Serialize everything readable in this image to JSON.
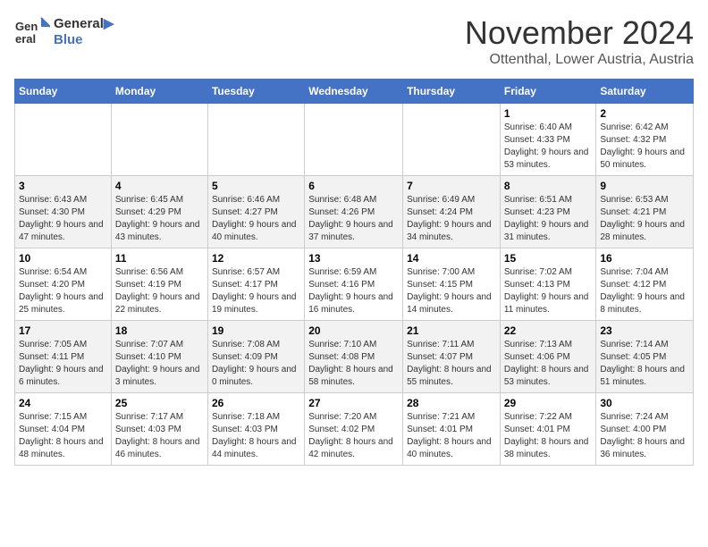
{
  "logo": {
    "line1": "General",
    "line2": "Blue"
  },
  "title": "November 2024",
  "subtitle": "Ottenthal, Lower Austria, Austria",
  "days_of_week": [
    "Sunday",
    "Monday",
    "Tuesday",
    "Wednesday",
    "Thursday",
    "Friday",
    "Saturday"
  ],
  "weeks": [
    [
      {
        "day": "",
        "info": ""
      },
      {
        "day": "",
        "info": ""
      },
      {
        "day": "",
        "info": ""
      },
      {
        "day": "",
        "info": ""
      },
      {
        "day": "",
        "info": ""
      },
      {
        "day": "1",
        "info": "Sunrise: 6:40 AM\nSunset: 4:33 PM\nDaylight: 9 hours and 53 minutes."
      },
      {
        "day": "2",
        "info": "Sunrise: 6:42 AM\nSunset: 4:32 PM\nDaylight: 9 hours and 50 minutes."
      }
    ],
    [
      {
        "day": "3",
        "info": "Sunrise: 6:43 AM\nSunset: 4:30 PM\nDaylight: 9 hours and 47 minutes."
      },
      {
        "day": "4",
        "info": "Sunrise: 6:45 AM\nSunset: 4:29 PM\nDaylight: 9 hours and 43 minutes."
      },
      {
        "day": "5",
        "info": "Sunrise: 6:46 AM\nSunset: 4:27 PM\nDaylight: 9 hours and 40 minutes."
      },
      {
        "day": "6",
        "info": "Sunrise: 6:48 AM\nSunset: 4:26 PM\nDaylight: 9 hours and 37 minutes."
      },
      {
        "day": "7",
        "info": "Sunrise: 6:49 AM\nSunset: 4:24 PM\nDaylight: 9 hours and 34 minutes."
      },
      {
        "day": "8",
        "info": "Sunrise: 6:51 AM\nSunset: 4:23 PM\nDaylight: 9 hours and 31 minutes."
      },
      {
        "day": "9",
        "info": "Sunrise: 6:53 AM\nSunset: 4:21 PM\nDaylight: 9 hours and 28 minutes."
      }
    ],
    [
      {
        "day": "10",
        "info": "Sunrise: 6:54 AM\nSunset: 4:20 PM\nDaylight: 9 hours and 25 minutes."
      },
      {
        "day": "11",
        "info": "Sunrise: 6:56 AM\nSunset: 4:19 PM\nDaylight: 9 hours and 22 minutes."
      },
      {
        "day": "12",
        "info": "Sunrise: 6:57 AM\nSunset: 4:17 PM\nDaylight: 9 hours and 19 minutes."
      },
      {
        "day": "13",
        "info": "Sunrise: 6:59 AM\nSunset: 4:16 PM\nDaylight: 9 hours and 16 minutes."
      },
      {
        "day": "14",
        "info": "Sunrise: 7:00 AM\nSunset: 4:15 PM\nDaylight: 9 hours and 14 minutes."
      },
      {
        "day": "15",
        "info": "Sunrise: 7:02 AM\nSunset: 4:13 PM\nDaylight: 9 hours and 11 minutes."
      },
      {
        "day": "16",
        "info": "Sunrise: 7:04 AM\nSunset: 4:12 PM\nDaylight: 9 hours and 8 minutes."
      }
    ],
    [
      {
        "day": "17",
        "info": "Sunrise: 7:05 AM\nSunset: 4:11 PM\nDaylight: 9 hours and 6 minutes."
      },
      {
        "day": "18",
        "info": "Sunrise: 7:07 AM\nSunset: 4:10 PM\nDaylight: 9 hours and 3 minutes."
      },
      {
        "day": "19",
        "info": "Sunrise: 7:08 AM\nSunset: 4:09 PM\nDaylight: 9 hours and 0 minutes."
      },
      {
        "day": "20",
        "info": "Sunrise: 7:10 AM\nSunset: 4:08 PM\nDaylight: 8 hours and 58 minutes."
      },
      {
        "day": "21",
        "info": "Sunrise: 7:11 AM\nSunset: 4:07 PM\nDaylight: 8 hours and 55 minutes."
      },
      {
        "day": "22",
        "info": "Sunrise: 7:13 AM\nSunset: 4:06 PM\nDaylight: 8 hours and 53 minutes."
      },
      {
        "day": "23",
        "info": "Sunrise: 7:14 AM\nSunset: 4:05 PM\nDaylight: 8 hours and 51 minutes."
      }
    ],
    [
      {
        "day": "24",
        "info": "Sunrise: 7:15 AM\nSunset: 4:04 PM\nDaylight: 8 hours and 48 minutes."
      },
      {
        "day": "25",
        "info": "Sunrise: 7:17 AM\nSunset: 4:03 PM\nDaylight: 8 hours and 46 minutes."
      },
      {
        "day": "26",
        "info": "Sunrise: 7:18 AM\nSunset: 4:03 PM\nDaylight: 8 hours and 44 minutes."
      },
      {
        "day": "27",
        "info": "Sunrise: 7:20 AM\nSunset: 4:02 PM\nDaylight: 8 hours and 42 minutes."
      },
      {
        "day": "28",
        "info": "Sunrise: 7:21 AM\nSunset: 4:01 PM\nDaylight: 8 hours and 40 minutes."
      },
      {
        "day": "29",
        "info": "Sunrise: 7:22 AM\nSunset: 4:01 PM\nDaylight: 8 hours and 38 minutes."
      },
      {
        "day": "30",
        "info": "Sunrise: 7:24 AM\nSunset: 4:00 PM\nDaylight: 8 hours and 36 minutes."
      }
    ]
  ]
}
